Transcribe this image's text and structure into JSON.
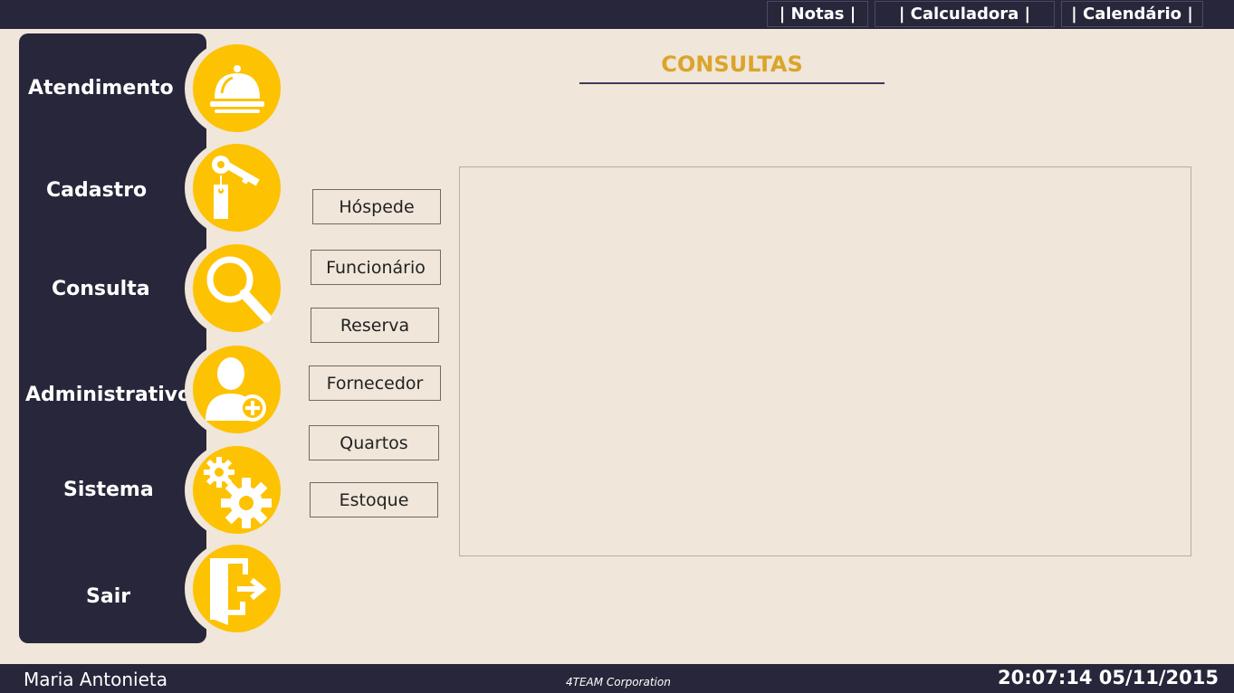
{
  "topbar": {
    "notas": "| Notas |",
    "calculadora": "| Calculadora |",
    "calendario": "| Calendário |"
  },
  "sidebar": {
    "items": [
      {
        "label": "Atendimento",
        "icon": "service-bell-icon"
      },
      {
        "label": "Cadastro",
        "icon": "key-tag-icon"
      },
      {
        "label": "Consulta",
        "icon": "magnifier-icon"
      },
      {
        "label": "Administrativo",
        "icon": "add-user-icon"
      },
      {
        "label": "Sistema",
        "icon": "gears-icon"
      },
      {
        "label": "Sair",
        "icon": "exit-door-icon"
      }
    ]
  },
  "main": {
    "title": "CONSULTAS",
    "buttons": [
      "Hóspede",
      "Funcionário",
      "Reserva",
      "Fornecedor",
      "Quartos",
      "Estoque"
    ]
  },
  "footer": {
    "user": "Maria Antonieta",
    "company": "4TEAM Corporation",
    "datetime": "20:07:14 05/11/2015"
  },
  "colors": {
    "background": "#f0e6d9",
    "dark": "#27263a",
    "accent": "#fdc202",
    "title": "#dba42a"
  }
}
